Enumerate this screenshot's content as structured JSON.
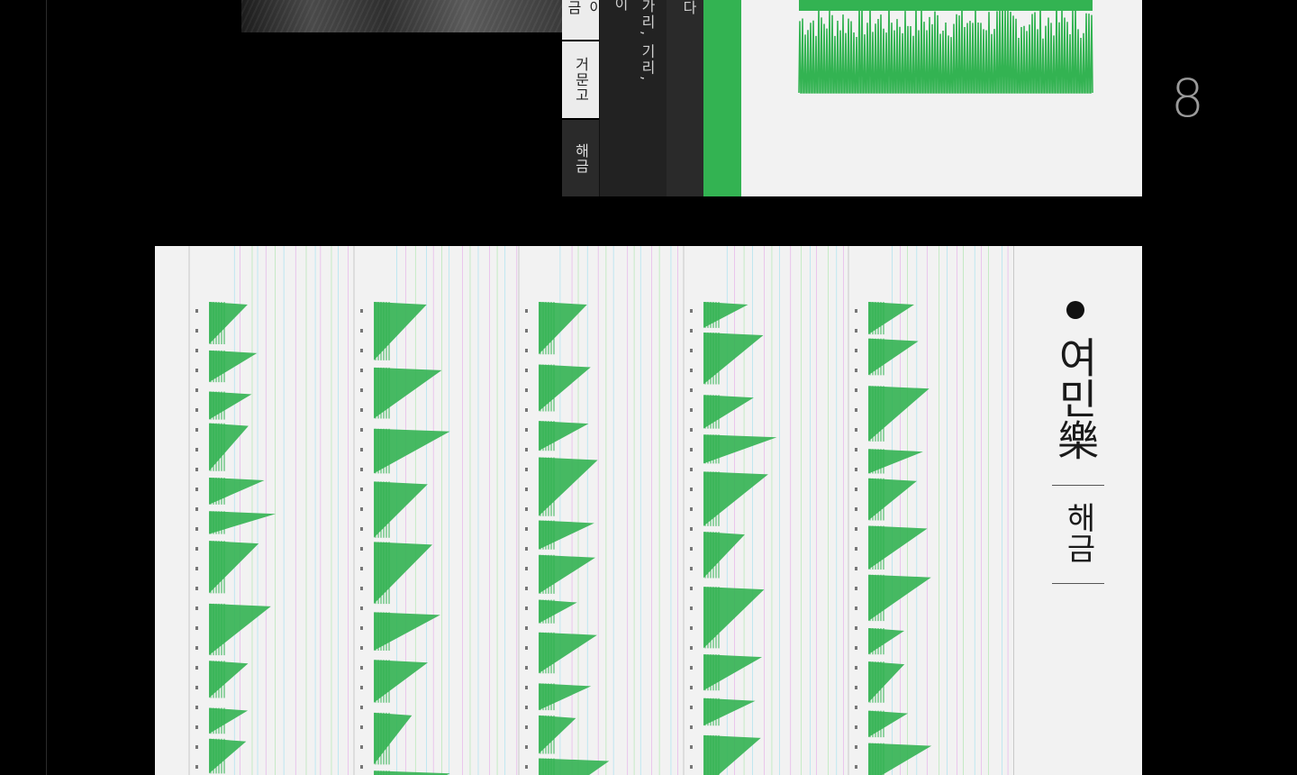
{
  "top": {
    "tabs": [
      "야금",
      "거문고",
      "해금"
    ],
    "lyrics_a": "이",
    "lyrics_b": "가리, 기리,",
    "lyrics_c": "다"
  },
  "page_number": "8",
  "piece": {
    "title": "여민樂",
    "instrument": "해금"
  },
  "colors": {
    "accent": "#33b352",
    "background": "#000000",
    "paper": "#f2f2f2"
  }
}
